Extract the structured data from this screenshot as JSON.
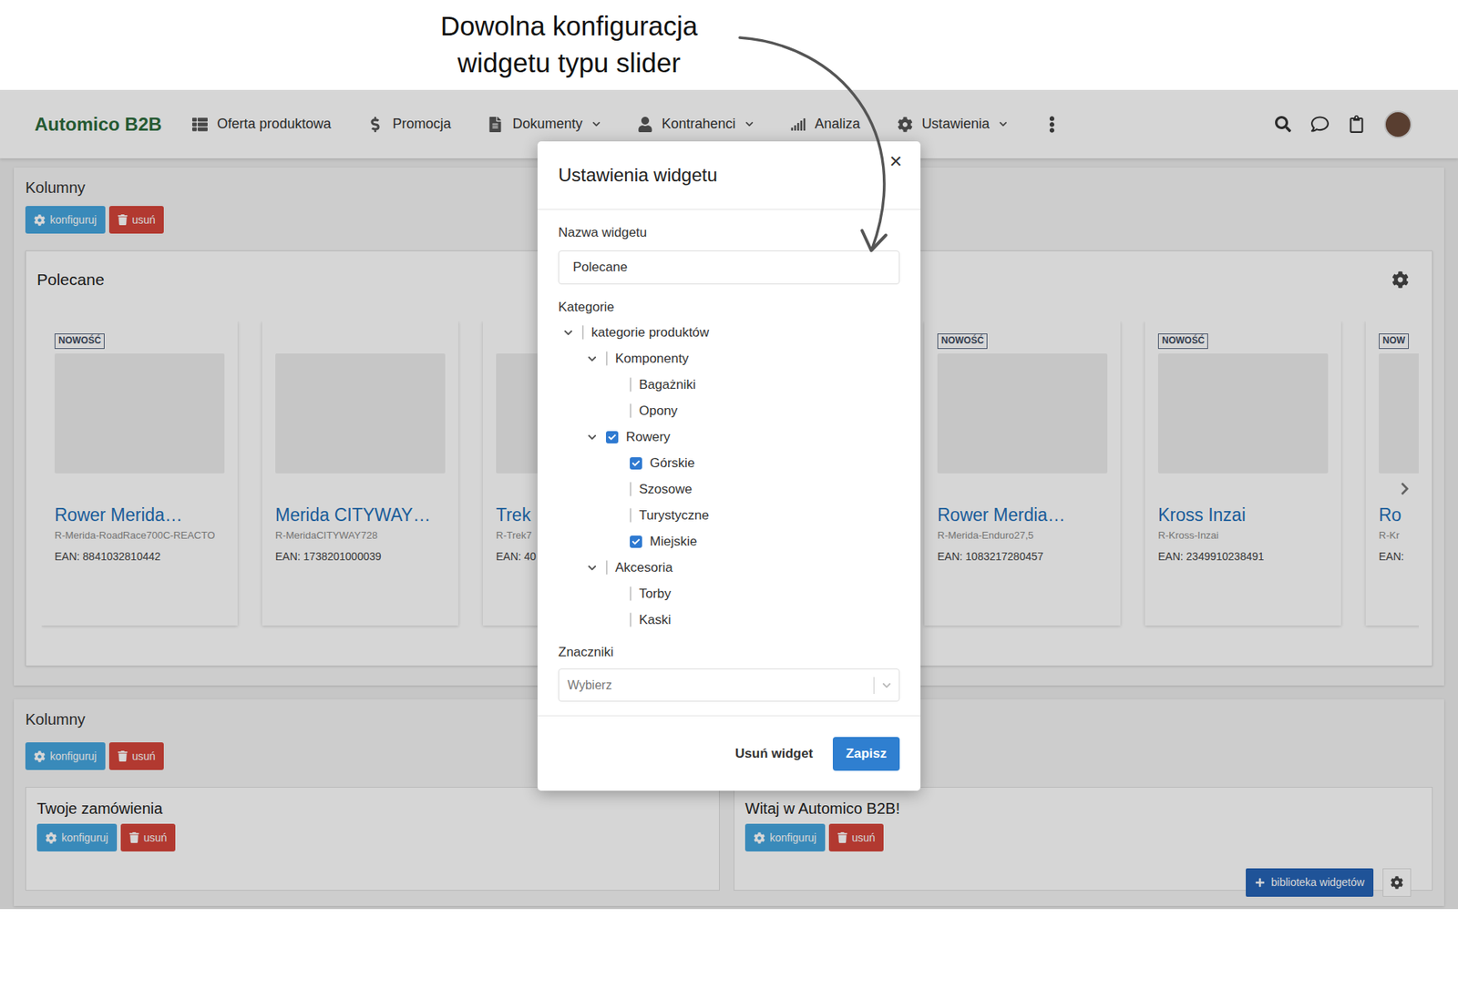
{
  "annotation": {
    "lines": [
      "Dowolna konfiguracja",
      "widgetu typu slider"
    ]
  },
  "navbar": {
    "logo": "Automico B2B",
    "items": [
      {
        "label": "Oferta produktowa",
        "dropdown": false
      },
      {
        "label": "Promocja",
        "dropdown": false
      },
      {
        "label": "Dokumenty",
        "dropdown": true
      },
      {
        "label": "Kontrahenci",
        "dropdown": true
      },
      {
        "label": "Analiza",
        "dropdown": false
      },
      {
        "label": "Ustawienia",
        "dropdown": true
      }
    ]
  },
  "sections": [
    {
      "title": "Kolumny",
      "buttons": [
        {
          "label": "konfiguruj",
          "kind": "configure"
        },
        {
          "label": "usuń",
          "kind": "delete"
        }
      ],
      "widget": {
        "title": "Polecane",
        "products": [
          {
            "covered": false,
            "badge": "NOWOŚĆ",
            "name": "Rower Merida…",
            "sku": "R-Merida-RoadRace700C-REACTO",
            "ean": "EAN: 8841032810442"
          },
          {
            "covered": false,
            "badge": "",
            "name": "Merida CITYWAY…",
            "sku": "R-MeridaCITYWAY728",
            "ean": "EAN: 1738201000039"
          },
          {
            "covered": false,
            "badge": "",
            "name": "Trek",
            "sku": "R-Trek7",
            "ean": "EAN: 40"
          },
          {
            "covered": true
          },
          {
            "covered": false,
            "badge": "NOWOŚĆ",
            "name": "Rower Merdia…",
            "sku": "R-Merida-Enduro27,5",
            "ean": "EAN: 1083217280457"
          },
          {
            "covered": false,
            "badge": "NOWOŚĆ",
            "name": "Kross Inzai",
            "sku": "R-Kross-Inzai",
            "ean": "EAN: 2349910238491"
          },
          {
            "covered": false,
            "badge": "NOW",
            "name": "Ro",
            "sku": "R-Kr",
            "ean": "EAN:"
          }
        ]
      }
    },
    {
      "title": "Kolumny",
      "buttons": [
        {
          "label": "konfiguruj",
          "kind": "configure"
        },
        {
          "label": "usuń",
          "kind": "delete"
        }
      ],
      "columns": [
        {
          "title": "Twoje zamówienia",
          "buttons": [
            {
              "label": "konfiguruj",
              "kind": "configure"
            },
            {
              "label": "usuń",
              "kind": "delete"
            }
          ]
        },
        {
          "title": "Witaj w Automico B2B!",
          "buttons": [
            {
              "label": "konfiguruj",
              "kind": "configure"
            },
            {
              "label": "usuń",
              "kind": "delete"
            }
          ]
        }
      ]
    }
  ],
  "library_button": "biblioteka widgetów",
  "modal": {
    "title": "Ustawienia widgetu",
    "close": "×",
    "name_label": "Nazwa widgetu",
    "name_value": "Polecane",
    "categories_label": "Kategorie",
    "tree": [
      {
        "label": "kategorie produktów",
        "expanded": true,
        "checked": false,
        "children": [
          {
            "label": "Komponenty",
            "expanded": true,
            "checked": false,
            "children": [
              {
                "label": "Bagażniki",
                "checked": false
              },
              {
                "label": "Opony",
                "checked": false
              }
            ]
          },
          {
            "label": "Rowery",
            "expanded": true,
            "checked": true,
            "children": [
              {
                "label": "Górskie",
                "checked": true
              },
              {
                "label": "Szosowe",
                "checked": false
              },
              {
                "label": "Turystyczne",
                "checked": false
              },
              {
                "label": "Miejskie",
                "checked": true
              }
            ]
          },
          {
            "label": "Akcesoria",
            "expanded": true,
            "checked": false,
            "children": [
              {
                "label": "Torby",
                "checked": false
              },
              {
                "label": "Kaski",
                "checked": false
              }
            ]
          }
        ]
      }
    ],
    "tags_label": "Znaczniki",
    "tags_placeholder": "Wybierz",
    "delete_button": "Usuń widget",
    "save_button": "Zapisz"
  }
}
